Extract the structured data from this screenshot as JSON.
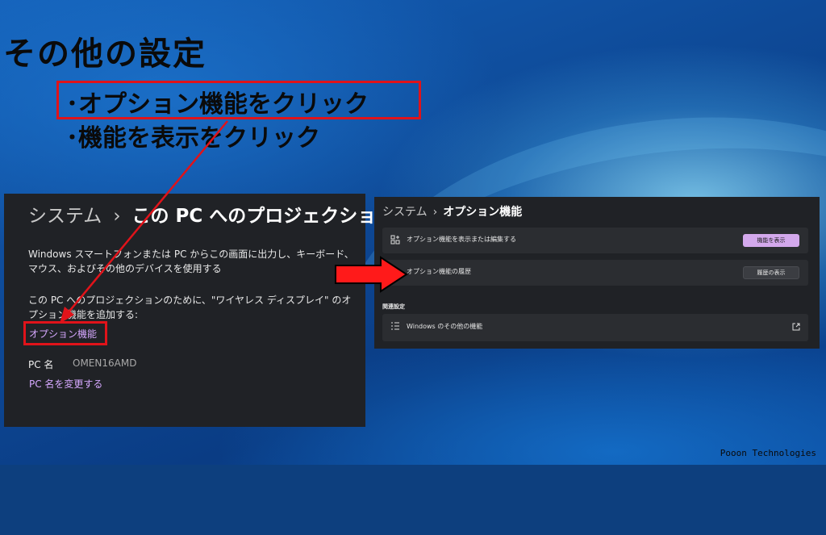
{
  "slide": {
    "title": "その他の設定",
    "steps": [
      "･オプション機能をクリック",
      "･機能を表示をクリック"
    ],
    "footer": "Pooon Technologies"
  },
  "left_panel": {
    "breadcrumb_parent": "システム",
    "breadcrumb_sep": "›",
    "breadcrumb_current": "この PC へのプロジェクション",
    "description_1": "Windows スマートフォンまたは PC からこの画面に出力し、キーボード、マウス、およびその他のデバイスを使用する",
    "description_2": "この PC へのプロジェクションのために、\"ワイヤレス ディスプレイ\" のオプション機能を追加する:",
    "optional_features_link": "オプション機能",
    "pc_name_label": "PC 名",
    "pc_name_value": "OMEN16AMD",
    "rename_pc_link": "PC 名を変更する"
  },
  "right_panel": {
    "breadcrumb_parent": "システム",
    "breadcrumb_sep": "›",
    "breadcrumb_current": "オプション機能",
    "rows": [
      {
        "label": "オプション機能を表示または編集する",
        "button": "機能を表示",
        "icon": "add-feature-icon"
      },
      {
        "label": "オプション機能の履歴",
        "button": "履歴の表示",
        "icon": "history-icon"
      }
    ],
    "related_section": "関連設定",
    "related_row": {
      "label": "Windows のその他の機能",
      "icon": "list-icon",
      "trailing_icon": "external-link-icon"
    }
  },
  "colors": {
    "highlight": "#e0131a",
    "accent_link": "#d6a8ff",
    "accent_button": "#d3a8ec",
    "panel_bg": "#202226"
  }
}
